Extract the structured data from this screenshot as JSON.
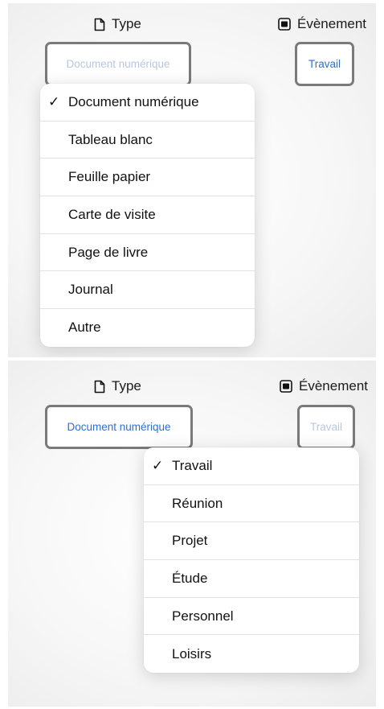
{
  "top_panel": {
    "type_label": "Type",
    "event_label": "Évènement",
    "type_value": "Document numérique",
    "event_value": "Travail",
    "menu_items": [
      {
        "label": "Document numérique",
        "checked": "✓"
      },
      {
        "label": "Tableau blanc",
        "checked": ""
      },
      {
        "label": "Feuille papier",
        "checked": ""
      },
      {
        "label": "Carte de visite",
        "checked": ""
      },
      {
        "label": "Page de livre",
        "checked": ""
      },
      {
        "label": "Journal",
        "checked": ""
      },
      {
        "label": "Autre",
        "checked": ""
      }
    ]
  },
  "bottom_panel": {
    "type_label": "Type",
    "event_label": "Évènement",
    "type_value": "Document numérique",
    "event_value": "Travail",
    "menu_items": [
      {
        "label": "Travail",
        "checked": "✓"
      },
      {
        "label": "Réunion",
        "checked": ""
      },
      {
        "label": "Projet",
        "checked": ""
      },
      {
        "label": "Étude",
        "checked": ""
      },
      {
        "label": "Personnel",
        "checked": ""
      },
      {
        "label": "Loisirs",
        "checked": ""
      }
    ]
  },
  "colors": {
    "accent": "#2f6fd0",
    "muted_value": "#b9c7dc",
    "field_border": "#7a7a7a"
  },
  "icons": {
    "type": "document-icon",
    "event": "calendar-stack-icon"
  }
}
